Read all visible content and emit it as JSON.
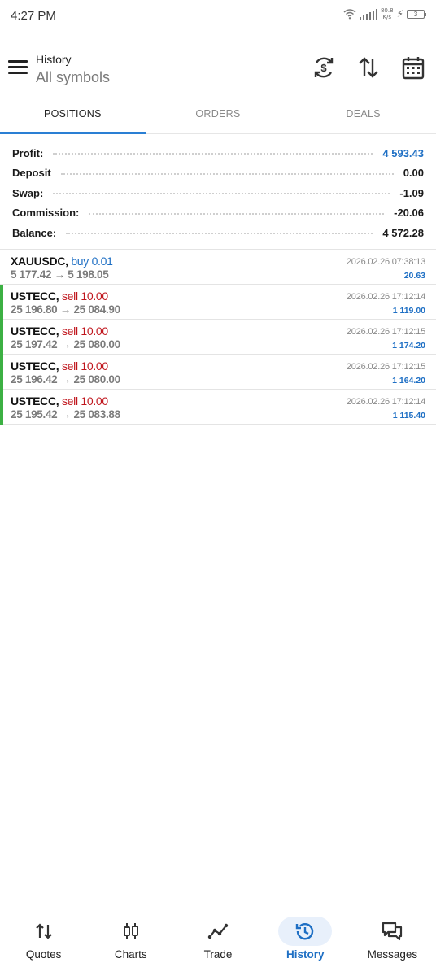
{
  "status_bar": {
    "time": "4:27 PM",
    "net_speed_value": "80.8",
    "net_speed_unit": "K/s",
    "battery": "3"
  },
  "header": {
    "title": "History",
    "subtitle": "All symbols",
    "icons": [
      "currency-refresh-icon",
      "sort-icon",
      "calendar-icon"
    ]
  },
  "tabs": [
    {
      "label": "POSITIONS",
      "active": true
    },
    {
      "label": "ORDERS",
      "active": false
    },
    {
      "label": "DEALS",
      "active": false
    }
  ],
  "summary": [
    {
      "label": "Profit:",
      "value": "4 593.43"
    },
    {
      "label": "Deposit",
      "value": "0.00"
    },
    {
      "label": "Swap:",
      "value": "-1.09"
    },
    {
      "label": "Commission:",
      "value": "-20.06"
    },
    {
      "label": "Balance:",
      "value": "4 572.28"
    }
  ],
  "positions": [
    {
      "symbol": "XAUUSDC,",
      "type": "buy 0.01",
      "prices": "5 177.42 → 5 198.05",
      "time": "2026.02.26 07:38:13",
      "profit": "20.63"
    },
    {
      "symbol": "USTECC,",
      "type": "sell 10.00",
      "prices": "25 196.80 → 25 084.90",
      "time": "2026.02.26 17:12:14",
      "profit": "1 119.00"
    },
    {
      "symbol": "USTECC,",
      "type": "sell 10.00",
      "prices": "25 197.42 → 25 080.00",
      "time": "2026.02.26 17:12:15",
      "profit": "1 174.20"
    },
    {
      "symbol": "USTECC,",
      "type": "sell 10.00",
      "prices": "25 196.42 → 25 080.00",
      "time": "2026.02.26 17:12:15",
      "profit": "1 164.20"
    },
    {
      "symbol": "USTECC,",
      "type": "sell 10.00",
      "prices": "25 195.42 → 25 083.88",
      "time": "2026.02.26 17:12:14",
      "profit": "1 115.40"
    }
  ],
  "bottom_nav": [
    {
      "label": "Quotes",
      "icon": "quotes-icon",
      "active": false
    },
    {
      "label": "Charts",
      "icon": "charts-icon",
      "active": false
    },
    {
      "label": "Trade",
      "icon": "trade-icon",
      "active": false
    },
    {
      "label": "History",
      "icon": "history-icon",
      "active": true
    },
    {
      "label": "Messages",
      "icon": "messages-icon",
      "active": false
    }
  ],
  "colors": {
    "accent": "#2a7fd4",
    "profit_blue": "#1e6fc4",
    "sell_red": "#c0161d",
    "sell_marker_green": "#3cb043"
  }
}
